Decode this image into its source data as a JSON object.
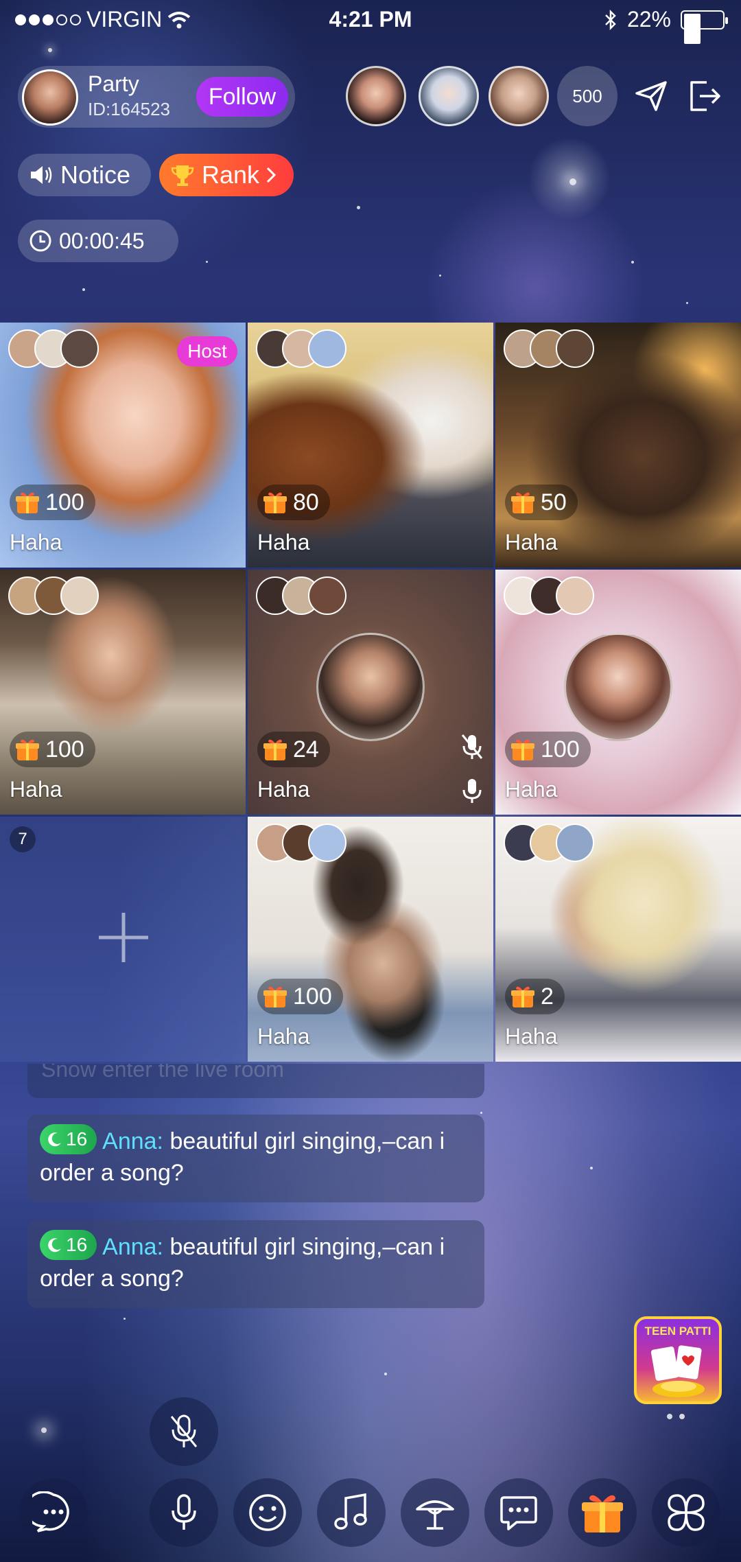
{
  "status_bar": {
    "carrier": "VIRGIN",
    "time": "4:21 PM",
    "battery": "22%"
  },
  "room": {
    "name": "Party",
    "id": "ID:164523",
    "follow_label": "Follow",
    "online_count": "500",
    "notice_label": "Notice",
    "rank_label": "Rank",
    "timer": "00:00:45"
  },
  "seats": [
    {
      "name": "Haha",
      "gifts": "100",
      "host_tag": "Host"
    },
    {
      "name": "Haha",
      "gifts": "80"
    },
    {
      "name": "Haha",
      "gifts": "50"
    },
    {
      "name": "Haha",
      "gifts": "100"
    },
    {
      "name": "Haha",
      "gifts": "24"
    },
    {
      "name": "Haha",
      "gifts": "100"
    },
    {
      "number": "7"
    },
    {
      "name": "Haha",
      "gifts": "100"
    },
    {
      "name": "Haha",
      "gifts": "2"
    }
  ],
  "chat": {
    "faded_text": "Snow enter the live room",
    "messages": [
      {
        "level": "16",
        "user": "Anna:",
        "text": " beautiful girl singing,–can i order a song?"
      },
      {
        "level": "16",
        "user": "Anna:",
        "text": " beautiful girl singing,–can i order a song?"
      }
    ]
  },
  "game": {
    "title": "TEEN PATTI"
  },
  "toolbar": {
    "icons": [
      "chat-bubble-icon",
      "mic-icon",
      "emoji-icon",
      "music-icon",
      "lamp-icon",
      "message-icon",
      "gift-icon",
      "more-apps-icon"
    ]
  },
  "colors": {
    "follow": "#b336f5",
    "rank": "#ff5a33",
    "host_tag": "#e83ad7",
    "username": "#5fe0ff",
    "level": "#2ec95a"
  }
}
